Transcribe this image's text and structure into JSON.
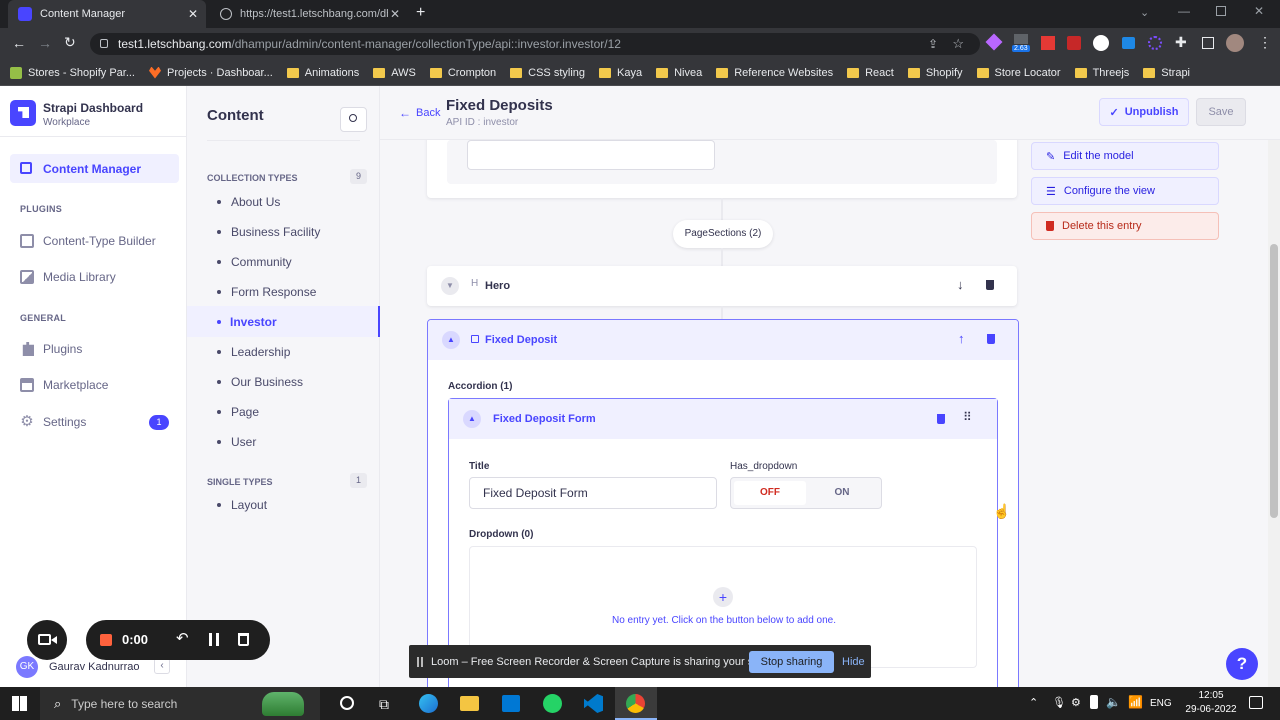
{
  "browser": {
    "tabs": [
      {
        "title": "Content Manager",
        "active": true
      },
      {
        "title": "https://test1.letschbang.com/dh",
        "active": false
      }
    ],
    "url_host": "test1.letschbang.com",
    "url_path": "/dhampur/admin/content-manager/collectionType/api::investor.investor/12",
    "bookmarks": [
      "Stores - Shopify Par...",
      "Projects · Dashboar...",
      "Animations",
      "AWS",
      "Crompton",
      "CSS styling",
      "Kaya",
      "Nivea",
      "Reference Websites",
      "React",
      "Shopify",
      "Store Locator",
      "Threejs",
      "Strapi"
    ],
    "extension_badge": "2.63"
  },
  "brand": {
    "title": "Strapi Dashboard",
    "subtitle": "Workplace",
    "accent": "#4945ff"
  },
  "nav": {
    "content_manager": "Content Manager",
    "plugins_heading": "PLUGINS",
    "content_type_builder": "Content-Type Builder",
    "media_library": "Media Library",
    "general_heading": "GENERAL",
    "plugins": "Plugins",
    "marketplace": "Marketplace",
    "settings": "Settings",
    "settings_badge": "1",
    "user_initials": "GK",
    "user_name": "Gaurav Kadnurrao"
  },
  "subnav": {
    "title": "Content",
    "collection_heading": "COLLECTION TYPES",
    "collection_count": "9",
    "collection_items": [
      "About Us",
      "Business Facility",
      "Community",
      "Form Response",
      "Investor",
      "Leadership",
      "Our Business",
      "Page",
      "User"
    ],
    "active_item": "Investor",
    "single_heading": "SINGLE TYPES",
    "single_count": "1",
    "single_items": [
      "Layout"
    ]
  },
  "header": {
    "back": "Back",
    "title": "Fixed Deposits",
    "api_id": "API ID : investor",
    "unpublish": "Unpublish",
    "save": "Save"
  },
  "actions": {
    "edit_model": "Edit the model",
    "configure_view": "Configure the view",
    "delete_entry": "Delete this entry"
  },
  "editor": {
    "page_sections": "PageSections (2)",
    "component_hero": "Hero",
    "component_fd": "Fixed Deposit",
    "accordion_label": "Accordion (1)",
    "accordion_item": "Fixed Deposit Form",
    "title_label": "Title",
    "title_value": "Fixed Deposit Form",
    "has_dropdown_label": "Has_dropdown",
    "toggle_off": "OFF",
    "toggle_on": "ON",
    "dropdown_label": "Dropdown (0)",
    "empty_text": "No entry yet. Click on the button below to add one."
  },
  "recorder": {
    "time": "0:00"
  },
  "loom": {
    "message": "Loom – Free Screen Recorder & Screen Capture is sharing your screen.",
    "stop": "Stop sharing",
    "hide": "Hide"
  },
  "taskbar": {
    "search_placeholder": "Type here to search",
    "lang": "ENG",
    "time": "12:05",
    "date": "29-06-2022"
  }
}
